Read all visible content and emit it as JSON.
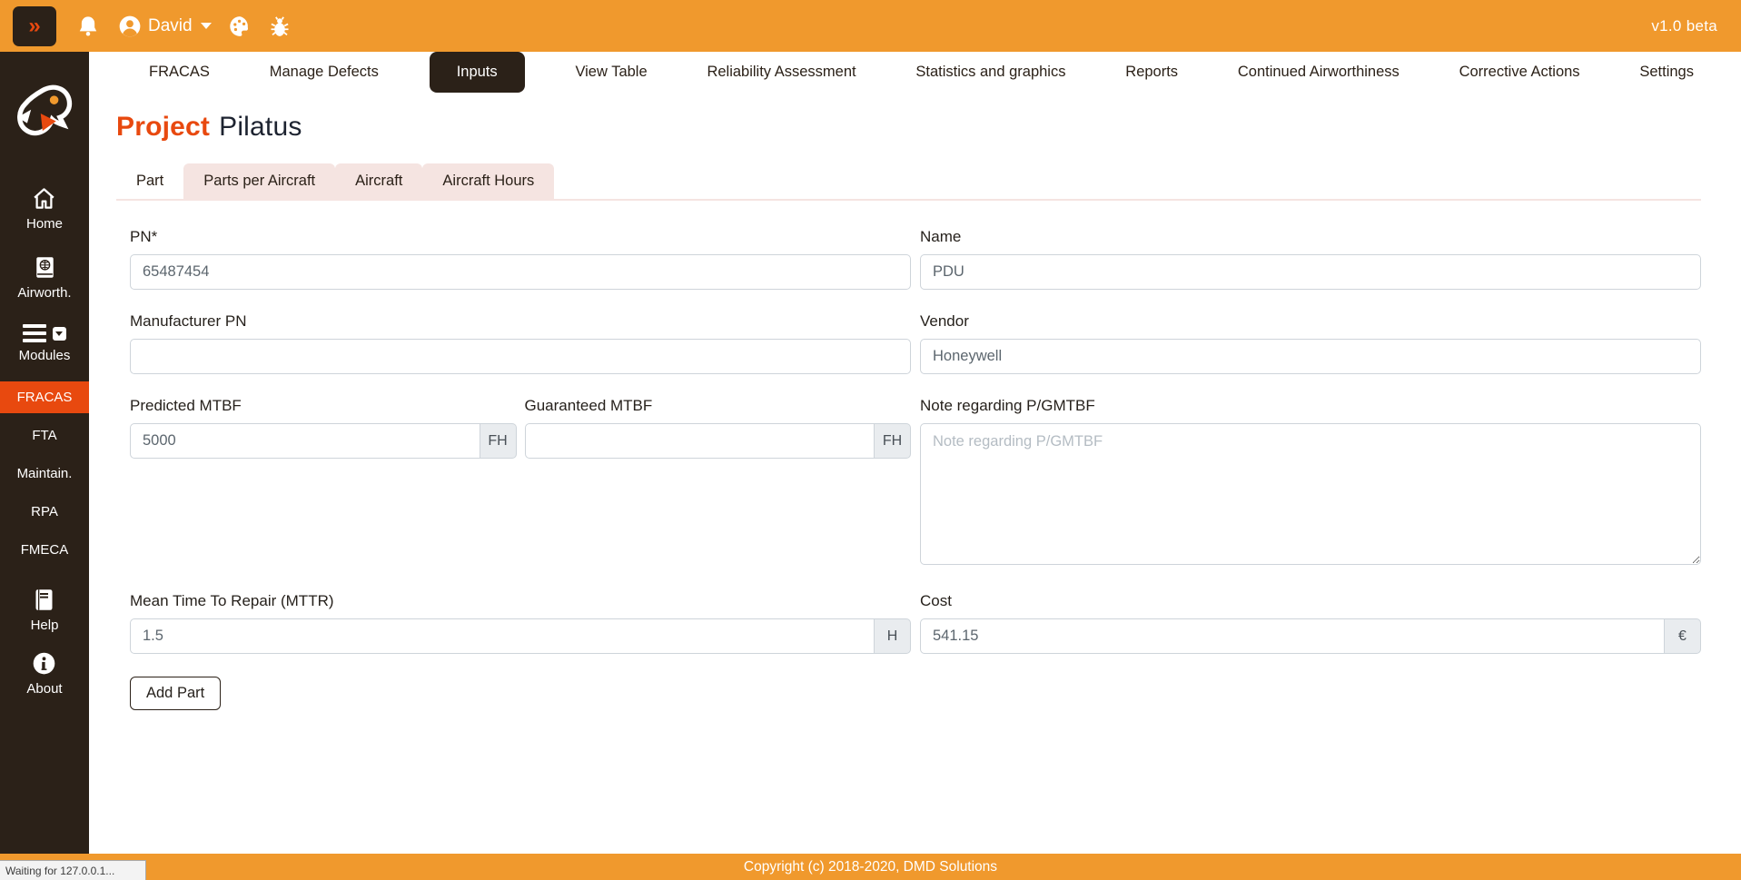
{
  "colors": {
    "orange": "#F0992D",
    "dark": "#2B2118",
    "accent": "#E8490F",
    "tab_pink": "#F5E4E1"
  },
  "topbar": {
    "collapse_label": "»",
    "user": "David",
    "version": "v1.0 beta"
  },
  "nav": {
    "items": [
      {
        "label": "FRACAS",
        "active": false
      },
      {
        "label": "Manage Defects",
        "active": false
      },
      {
        "label": "Inputs",
        "active": true
      },
      {
        "label": "View Table",
        "active": false
      },
      {
        "label": "Reliability Assessment",
        "active": false
      },
      {
        "label": "Statistics and graphics",
        "active": false
      },
      {
        "label": "Reports",
        "active": false
      },
      {
        "label": "Continued Airworthiness",
        "active": false
      },
      {
        "label": "Corrective Actions",
        "active": false
      },
      {
        "label": "Settings",
        "active": false
      }
    ]
  },
  "sidebar": {
    "items": [
      {
        "label": "Home",
        "icon": "home-icon"
      },
      {
        "label": "Airworth.",
        "icon": "book-globe-icon"
      },
      {
        "label": "Modules",
        "icon": "menu-icon"
      },
      {
        "label": "FRACAS",
        "active": true
      },
      {
        "label": "FTA",
        "active": false
      },
      {
        "label": "Maintain.",
        "active": false
      },
      {
        "label": "RPA",
        "active": false
      },
      {
        "label": "FMECA",
        "active": false
      },
      {
        "label": "Help",
        "icon": "book-icon"
      },
      {
        "label": "About",
        "icon": "info-icon"
      }
    ]
  },
  "page": {
    "title_prefix": "Project",
    "title_name": "Pilatus"
  },
  "tabs": [
    {
      "label": "Part",
      "active": true
    },
    {
      "label": "Parts per Aircraft",
      "active": false
    },
    {
      "label": "Aircraft",
      "active": false
    },
    {
      "label": "Aircraft Hours",
      "active": false
    }
  ],
  "form": {
    "pn": {
      "label": "PN*",
      "value": "65487454"
    },
    "name": {
      "label": "Name",
      "value": "PDU"
    },
    "manufacturer_pn": {
      "label": "Manufacturer PN",
      "value": ""
    },
    "vendor": {
      "label": "Vendor",
      "value": "Honeywell"
    },
    "predicted_mtbf": {
      "label": "Predicted MTBF",
      "value": "5000",
      "unit": "FH"
    },
    "guaranteed_mtbf": {
      "label": "Guaranteed MTBF",
      "value": "",
      "unit": "FH"
    },
    "note": {
      "label": "Note regarding P/GMTBF",
      "value": "",
      "placeholder": "Note regarding P/GMTBF"
    },
    "mttr": {
      "label": "Mean Time To Repair (MTTR)",
      "value": "1.5",
      "unit": "H"
    },
    "cost": {
      "label": "Cost",
      "value": "541.15",
      "unit": "€"
    },
    "submit_label": "Add Part"
  },
  "footer": {
    "copyright": "Copyright (c) 2018-2020, DMD Solutions"
  },
  "statusbar": {
    "text": "Waiting for 127.0.0.1..."
  }
}
